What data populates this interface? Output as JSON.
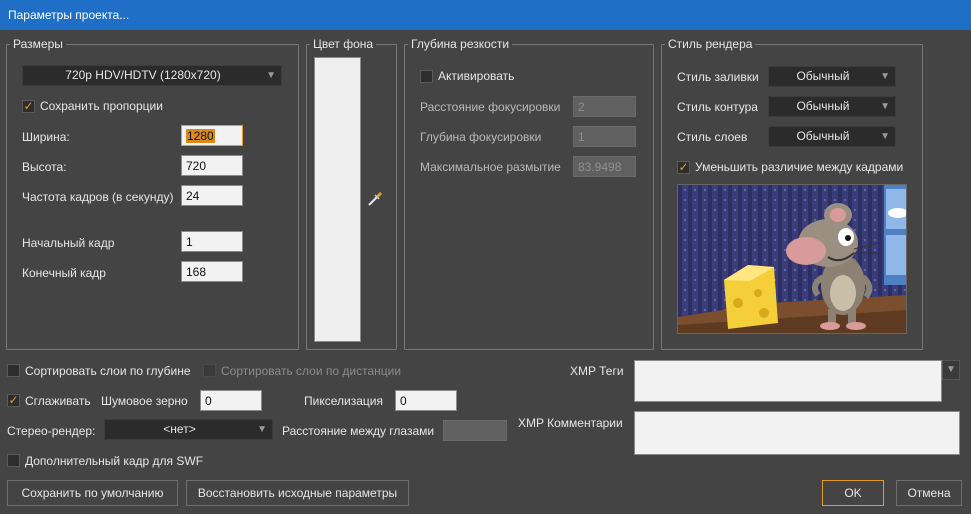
{
  "window": {
    "title": "Параметры проекта..."
  },
  "size_group": {
    "title": "Размеры",
    "preset": "720p HDV/HDTV (1280x720)",
    "keep_ratio_label": "Сохранить пропорции",
    "width_label": "Ширина:",
    "width_value": "1280",
    "height_label": "Высота:",
    "height_value": "720",
    "fps_label": "Частота кадров (в секунду)",
    "fps_value": "24",
    "start_label": "Начальный кадр",
    "start_value": "1",
    "end_label": "Конечный кадр",
    "end_value": "168"
  },
  "bg_group": {
    "title": "Цвет фона",
    "color": "#efefef"
  },
  "dof_group": {
    "title": "Глубина резкости",
    "enable_label": "Активировать",
    "focus_distance_label": "Расстояние фокусировки",
    "focus_distance_value": "2",
    "focus_depth_label": "Глубина фокусировки",
    "focus_depth_value": "1",
    "max_blur_label": "Максимальное размытие",
    "max_blur_value": "83.9498"
  },
  "render_group": {
    "title": "Стиль рендера",
    "fill_label": "Стиль заливки",
    "fill_value": "Обычный",
    "outline_label": "Стиль контура",
    "outline_value": "Обычный",
    "layers_label": "Стиль слоев",
    "layers_value": "Обычный",
    "reduce_label": "Уменьшить различие между кадрами"
  },
  "bottom": {
    "sort_depth_label": "Сортировать слои по глубине",
    "sort_distance_label": "Сортировать слои по дистанции",
    "antialias_label": "Сглаживать",
    "noise_label": "Шумовое зерно",
    "noise_value": "0",
    "pixel_label": "Пикселизация",
    "pixel_value": "0",
    "stereo_label": "Стерео-рендер:",
    "stereo_value": "<нет>",
    "eye_distance_label": "Расстояние между глазами",
    "swf_label": "Дополнительный кадр для SWF",
    "xmp_tags_label": "XMP Теги",
    "xmp_comments_label": "XMP Комментарии"
  },
  "buttons": {
    "save_default": "Сохранить по умолчанию",
    "restore": "Восстановить исходные параметры",
    "ok": "OK",
    "cancel": "Отмена"
  },
  "icons": {
    "check": "✓",
    "dropdown_arrow": "▼"
  },
  "colors": {
    "titlebar": "#1f6fc6",
    "background": "#444444",
    "accent": "#e39b25"
  }
}
